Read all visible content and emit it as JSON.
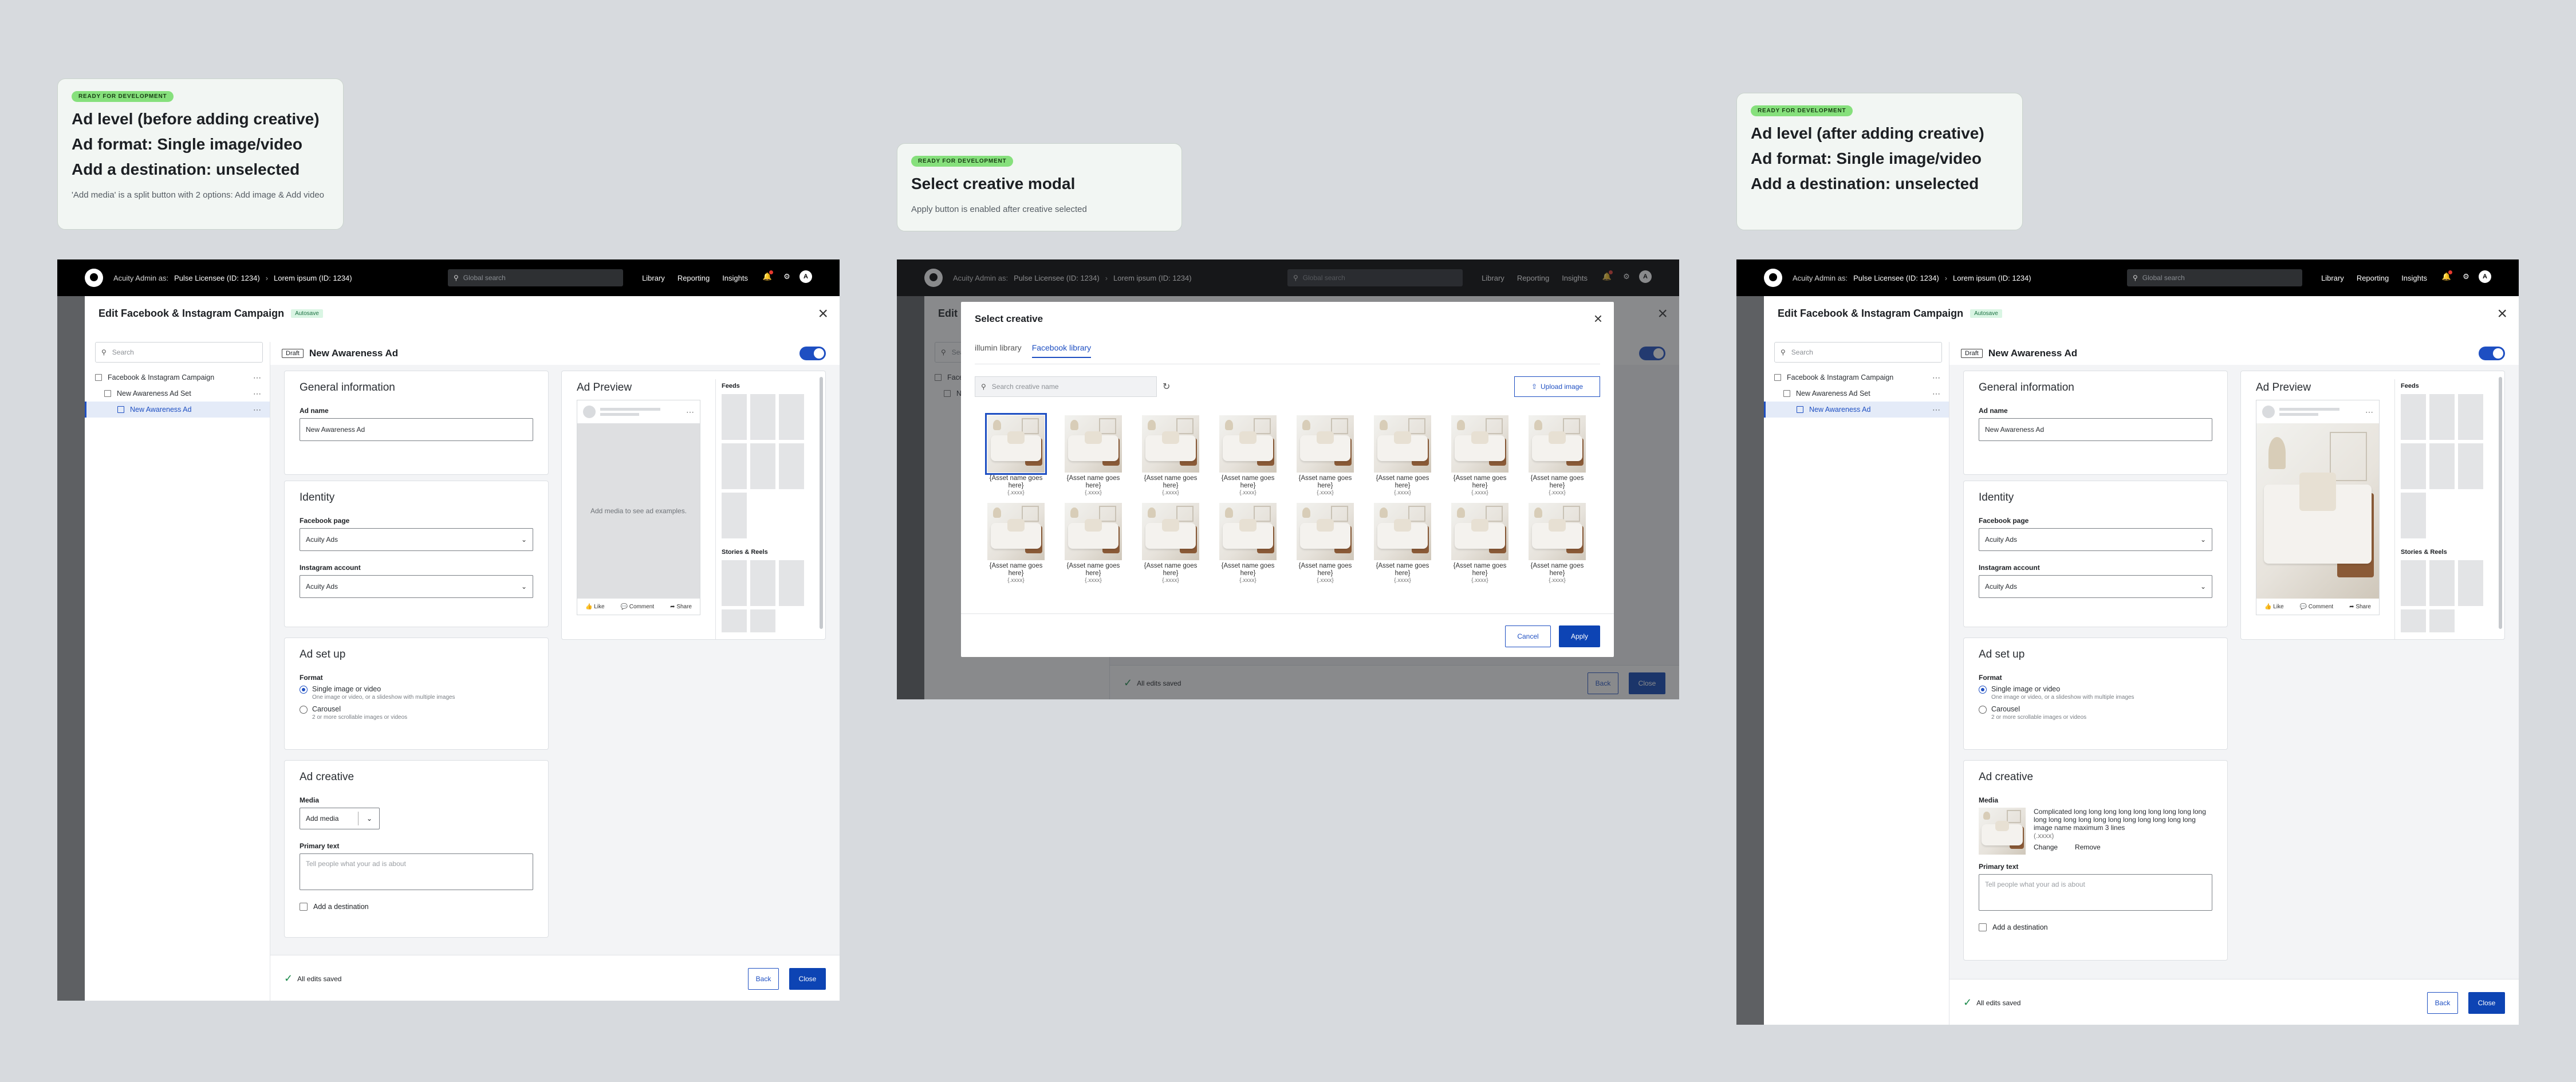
{
  "notes": [
    {
      "badge": "READY FOR DEVELOPMENT",
      "lines": [
        "Ad level (before adding creative)",
        "Ad format: Single image/video",
        "Add a destination: unselected"
      ],
      "desc": "'Add media' is a split button with 2 options: Add image & Add video"
    },
    {
      "badge": "READY FOR DEVELOPMENT",
      "lines": [
        "Select creative modal"
      ],
      "desc": "Apply button is enabled after creative selected"
    },
    {
      "badge": "READY FOR DEVELOPMENT",
      "lines": [
        "Ad level (after adding creative)",
        "Ad format: Single image/video",
        "Add a destination: unselected"
      ],
      "desc": ""
    }
  ],
  "topbar": {
    "admin_as": "Acuity Admin as:",
    "licensee": "Pulse Licensee (ID: 1234)",
    "sub": "Lorem ipsum (ID: 1234)",
    "search_placeholder": "Global search",
    "nav": [
      "Library",
      "Reporting",
      "Insights"
    ],
    "avatar": "A"
  },
  "panel": {
    "title": "Edit Facebook & Instagram Campaign",
    "autosave": "Autosave",
    "sidebar_search": "Search",
    "tree": [
      "Facebook & Instagram Campaign",
      "New Awareness Ad Set",
      "New Awareness Ad"
    ],
    "draft": "Draft",
    "ad_name": "New Awareness Ad"
  },
  "general": {
    "title": "General information",
    "ad_name_label": "Ad name",
    "ad_name_value": "New Awareness Ad"
  },
  "identity": {
    "title": "Identity",
    "fb_label": "Facebook page",
    "fb_value": "Acuity Ads",
    "ig_label": "Instagram account",
    "ig_value": "Acuity Ads"
  },
  "setup": {
    "title": "Ad set up",
    "format_label": "Format",
    "opt1": "Single image or video",
    "opt1_sub": "One image or video, or a slideshow with multiple images",
    "opt2": "Carousel",
    "opt2_sub": "2 or more scrollable images or videos"
  },
  "creative": {
    "title": "Ad creative",
    "media_label": "Media",
    "add_media": "Add media",
    "primary_label": "Primary text",
    "primary_placeholder": "Tell people what your ad is about",
    "destination": "Add a destination",
    "asset_name": "Complicated long long long long long long long long long long long long long long long long long long long long image name maximum 3 lines",
    "asset_ext": "(.xxxx)",
    "change": "Change",
    "remove": "Remove"
  },
  "preview": {
    "title": "Ad Preview",
    "empty": "Add media to see ad examples.",
    "like": "Like",
    "comment": "Comment",
    "share": "Share",
    "feeds": "Feeds",
    "stories": "Stories & Reels"
  },
  "footer": {
    "saved": "All edits saved",
    "back": "Back",
    "close": "Close"
  },
  "modal": {
    "title": "Select creative",
    "tabs": [
      "illumin library",
      "Facebook library"
    ],
    "search_placeholder": "Search creative name",
    "upload": "Upload image",
    "asset_name": "{Asset name goes here}",
    "asset_ext": "{.xxxx}",
    "cancel": "Cancel",
    "apply": "Apply"
  },
  "colors": {
    "primary": "#0d44b4",
    "badge": "#86e07c",
    "selected_tree": "#e4ebf8"
  },
  "icons": [
    "logo",
    "search-icon",
    "bell-icon",
    "gear-icon",
    "close-icon",
    "chevron-down-icon",
    "refresh-icon",
    "upload-icon",
    "check-icon",
    "toggle-switch"
  ]
}
